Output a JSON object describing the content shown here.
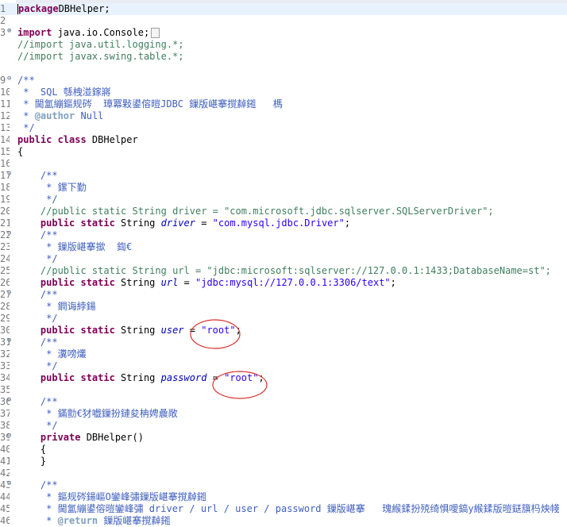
{
  "editor": {
    "lines": [
      {
        "n": "1",
        "segs": [
          [
            "kw",
            "package"
          ],
          [
            "",
            "DBHelper;"
          ]
        ]
      },
      {
        "n": "2",
        "segs": []
      },
      {
        "n": "3",
        "fold": "collapsed",
        "segs": [
          [
            "kw",
            "import"
          ],
          [
            "",
            " java.io.Console;"
          ]
        ],
        "box": true
      },
      {
        "n": "",
        "segs": [
          [
            "cm",
            "//import java.util.logging.*;"
          ]
        ]
      },
      {
        "n": "",
        "segs": [
          [
            "cm",
            "//import javax.swing.table.*;"
          ]
        ]
      },
      {
        "n": "",
        "segs": []
      },
      {
        "n": "9",
        "fold": "open",
        "segs": [
          [
            "jd",
            "/**"
          ]
        ]
      },
      {
        "n": "10",
        "segs": [
          [
            "jd",
            " *  SQL 綔栧湴鎵嶈"
          ]
        ]
      },
      {
        "n": "11",
        "segs": [
          [
            "jd",
            " * 閫氳繃鏂规硶  璋冪敤鍙傛暟JDBC 鏁版嵁搴撹繛鎺   榪"
          ]
        ]
      },
      {
        "n": "12",
        "segs": [
          [
            "jd",
            " * "
          ],
          [
            "jdtag",
            "@author"
          ],
          [
            "jd",
            " Null"
          ]
        ]
      },
      {
        "n": "13",
        "segs": [
          [
            "jd",
            " */"
          ]
        ]
      },
      {
        "n": "14",
        "segs": [
          [
            "kw",
            "public class"
          ],
          [
            "",
            " DBHelper"
          ]
        ]
      },
      {
        "n": "15",
        "segs": [
          [
            "",
            "{"
          ]
        ]
      },
      {
        "n": "16",
        "segs": []
      },
      {
        "n": "17",
        "fold": "open",
        "segs": [
          [
            "",
            "    "
          ],
          [
            "jd",
            "/**"
          ]
        ]
      },
      {
        "n": "18",
        "segs": [
          [
            "jd",
            "     * 鏍下勤"
          ]
        ]
      },
      {
        "n": "19",
        "segs": [
          [
            "jd",
            "     */"
          ]
        ]
      },
      {
        "n": "20",
        "segs": [
          [
            "cm",
            "    //public static String driver = \"com.microsoft.jdbc.sqlserver.SQLServerDriver\";"
          ]
        ]
      },
      {
        "n": "21",
        "segs": [
          [
            "",
            "    "
          ],
          [
            "kw",
            "public static"
          ],
          [
            "",
            " String "
          ],
          [
            "fld",
            "driver"
          ],
          [
            "",
            " = "
          ],
          [
            "str",
            "\"com.mysql.jdbc.Driver\""
          ],
          [
            "",
            ";"
          ]
        ]
      },
      {
        "n": "22",
        "fold": "open",
        "segs": [
          [
            "",
            "    "
          ],
          [
            "jd",
            "/**"
          ]
        ]
      },
      {
        "n": "23",
        "segs": [
          [
            "jd",
            "     * 鏁版嵁搴撳  鍧€"
          ]
        ]
      },
      {
        "n": "24",
        "segs": [
          [
            "jd",
            "     */"
          ]
        ]
      },
      {
        "n": "25",
        "segs": [
          [
            "cm",
            "    //public static String url = \"jdbc:microsoft:sqlserver://127.0.0.1:1433;DatabaseName=st\";"
          ]
        ]
      },
      {
        "n": "26",
        "segs": [
          [
            "",
            "    "
          ],
          [
            "kw",
            "public static"
          ],
          [
            "",
            " String "
          ],
          [
            "fld",
            "url"
          ],
          [
            "",
            " = "
          ],
          [
            "str",
            "\"jdbc:mysql://127.0.0.1:3306/text\""
          ],
          [
            "",
            ";"
          ]
        ]
      },
      {
        "n": "27",
        "fold": "open",
        "segs": [
          [
            "",
            "    "
          ],
          [
            "jd",
            "/**"
          ]
        ]
      },
      {
        "n": "28",
        "segs": [
          [
            "jd",
            "     * 鐧诲綍鍚"
          ]
        ]
      },
      {
        "n": "29",
        "segs": [
          [
            "jd",
            "     */"
          ]
        ]
      },
      {
        "n": "30",
        "segs": [
          [
            "",
            "    "
          ],
          [
            "kw",
            "public static"
          ],
          [
            "",
            " String "
          ],
          [
            "fld",
            "user"
          ],
          [
            "",
            " = "
          ],
          [
            "str",
            "\"root\""
          ],
          [
            "",
            ";"
          ]
        ]
      },
      {
        "n": "31",
        "fold": "open",
        "segs": [
          [
            "",
            "    "
          ],
          [
            "jd",
            "/**"
          ]
        ]
      },
      {
        "n": "32",
        "segs": [
          [
            "jd",
            "     * 瀵嗙爜"
          ]
        ]
      },
      {
        "n": "33",
        "segs": [
          [
            "jd",
            "     */"
          ]
        ]
      },
      {
        "n": "34",
        "segs": [
          [
            "",
            "    "
          ],
          [
            "kw",
            "public static"
          ],
          [
            "",
            " String "
          ],
          [
            "fld",
            "password"
          ],
          [
            "",
            " = "
          ],
          [
            "str",
            "\"root\""
          ],
          [
            "",
            ";"
          ]
        ]
      },
      {
        "n": "35",
        "segs": []
      },
      {
        "n": "36",
        "fold": "open",
        "segs": [
          [
            "",
            "    "
          ],
          [
            "jd",
            "/**"
          ]
        ]
      },
      {
        "n": "37",
        "segs": [
          [
            "jd",
            "     * 鏋勯€犲嚱鏁扮鏈夋柟娉曟敞"
          ]
        ]
      },
      {
        "n": "38",
        "segs": [
          [
            "jd",
            "     */"
          ]
        ]
      },
      {
        "n": "39",
        "fold": "open",
        "segs": [
          [
            "",
            "    "
          ],
          [
            "kw",
            "private"
          ],
          [
            "",
            " DBHelper()"
          ]
        ]
      },
      {
        "n": "40",
        "segs": [
          [
            "",
            "    {"
          ]
        ]
      },
      {
        "n": "41",
        "segs": [
          [
            "",
            "    }"
          ]
        ]
      },
      {
        "n": "42",
        "segs": []
      },
      {
        "n": "43",
        "fold": "open",
        "segs": [
          [
            "",
            "    "
          ],
          [
            "jd",
            "/**"
          ]
        ]
      },
      {
        "n": "44",
        "segs": [
          [
            "jd",
            "     * 鏂规硶鍚嶇О鑾峰彇鏁版嵁搴撹繛鎺"
          ]
        ]
      },
      {
        "n": "45",
        "segs": [
          [
            "jd",
            "     * 閫氳繃鍙傛暟鑾峰彇 driver / url / user / password 鏁版嵁搴   瑰緱鍒扮殑绮惧噯鎬у緱鍒版暟鎹簱杩炴帴"
          ]
        ]
      },
      {
        "n": "46",
        "segs": [
          [
            "jd",
            "     * "
          ],
          [
            "jdtag",
            "@return"
          ],
          [
            "jd",
            " 鏁版嵁搴撹繛鎺"
          ]
        ]
      }
    ]
  }
}
